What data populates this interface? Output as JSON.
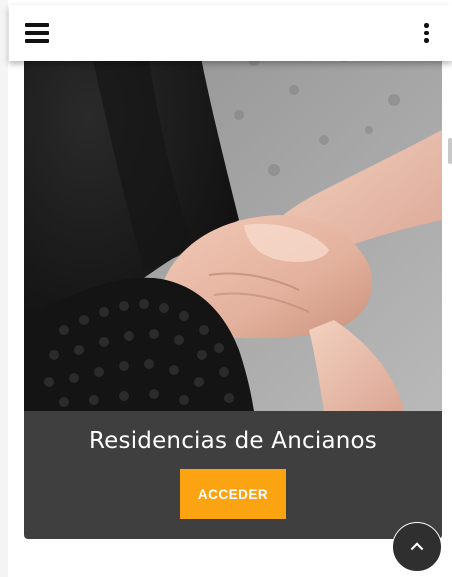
{
  "header": {
    "menu_icon": "hamburger-menu-icon",
    "more_icon": "vertical-dots-icon"
  },
  "card": {
    "image_alt": "holding hands",
    "title": "Residencias de Ancianos",
    "button_label": "ACCEDER",
    "accent_color": "#fca311",
    "card_color": "#3f3f3f"
  },
  "scroll_top": {
    "icon": "chevron-up-icon"
  }
}
